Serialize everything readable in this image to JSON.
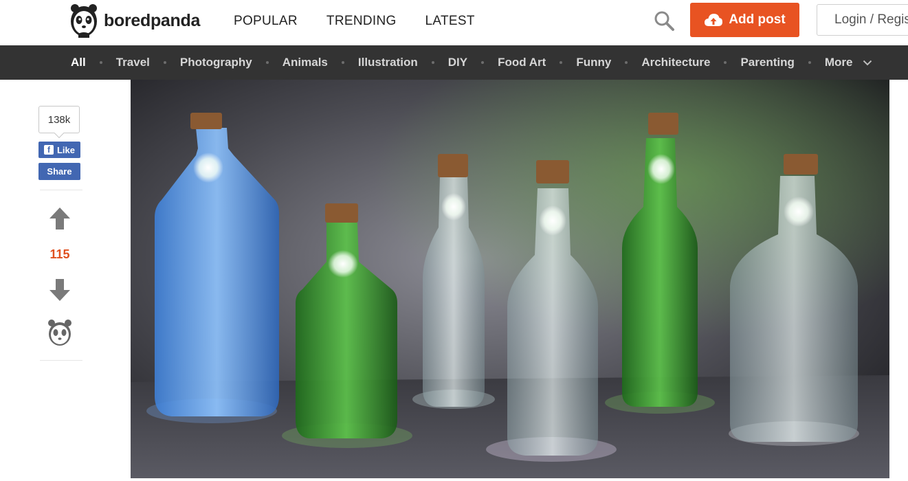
{
  "header": {
    "logo_text": "boredpanda",
    "nav": [
      "POPULAR",
      "TRENDING",
      "LATEST"
    ],
    "add_post_label": "Add post",
    "login_label": "Login / Register"
  },
  "categories": {
    "items": [
      "All",
      "Travel",
      "Photography",
      "Animals",
      "Illustration",
      "DIY",
      "Food Art",
      "Funny",
      "Architecture",
      "Parenting",
      "More"
    ],
    "active": "All"
  },
  "share": {
    "like_count": "138k",
    "like_label": "Like",
    "share_label": "Share",
    "votes": "115"
  },
  "colors": {
    "accent": "#e85322",
    "category_bar": "#333333",
    "facebook": "#4267b2",
    "vote_count": "#e0501f"
  }
}
